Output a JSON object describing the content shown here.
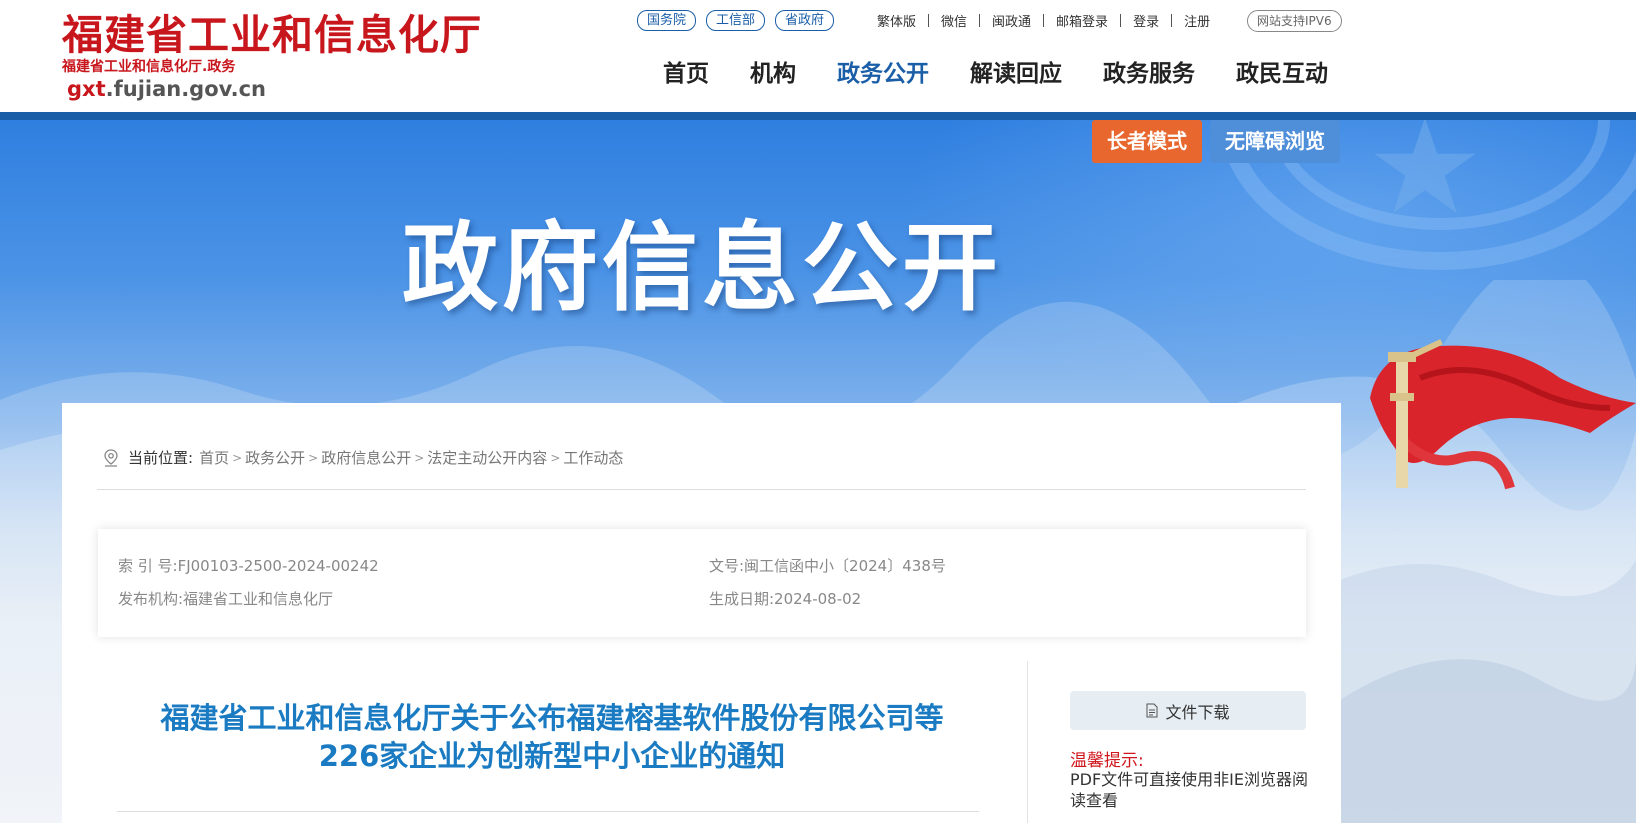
{
  "logo": {
    "title": "福建省工业和信息化厅",
    "subtitle": "福建省工业和信息化厅.政务",
    "domain_prefix": "gxt",
    "domain_rest": ".fujian.gov.cn"
  },
  "top_links": {
    "pills": [
      "国务院",
      "工信部",
      "省政府"
    ],
    "utils": [
      "繁体版",
      "微信",
      "闽政通",
      "邮箱登录",
      "登录",
      "注册"
    ],
    "ipv6": "网站支持IPV6"
  },
  "nav": {
    "items": [
      "首页",
      "机构",
      "政务公开",
      "解读回应",
      "政务服务",
      "政民互动"
    ],
    "active_index": 2
  },
  "banner": {
    "title": "政府信息公开",
    "elder_mode": "长者模式",
    "barrier_free": "无障碍浏览"
  },
  "breadcrumb": {
    "label": "当前位置:",
    "items": [
      "首页",
      "政务公开",
      "政府信息公开",
      "法定主动公开内容",
      "工作动态"
    ]
  },
  "meta": {
    "index_no": "索 引 号:FJ00103-2500-2024-00242",
    "doc_no": "文号:闽工信函中小〔2024〕438号",
    "publisher": "发布机构:福建省工业和信息化厅",
    "date": "生成日期:2024-08-02"
  },
  "document": {
    "title_line1": "福建省工业和信息化厅关于公布福建榕基软件股份有限公司等",
    "title_line2": "226家企业为创新型中小企业的通知"
  },
  "sidebar": {
    "download_label": "文件下载",
    "tip_title": "温馨提示:",
    "tip_text": "PDF文件可直接使用非IE浏览器阅读查看"
  },
  "colors": {
    "brand_red": "#c8161d",
    "brand_blue": "#1a5ea8",
    "title_blue": "#1a7bc2",
    "elder_orange": "#e8672e"
  }
}
